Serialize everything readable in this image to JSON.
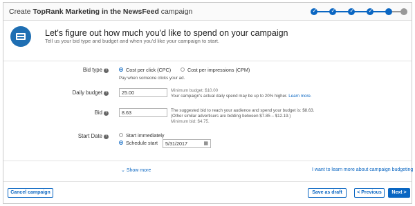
{
  "header": {
    "title_prefix": "Create ",
    "title_campaign": "TopRank Marketing in the NewsFeed",
    "title_suffix": " campaign"
  },
  "intro": {
    "icon": "credit-card-icon",
    "heading": "Let's figure out how much you'd like to spend on your campaign",
    "subtext": "Tell us your bid type and budget and when you'd like your campaign to start."
  },
  "form": {
    "bid_type": {
      "label": "Bid type",
      "option_cpc": "Cost per click (CPC)",
      "option_cpm": "Cost per impressions (CPM)",
      "selected": "cpc",
      "hint": "Pay when someone clicks your ad."
    },
    "daily_budget": {
      "label": "Daily budget",
      "value": "25.00",
      "min_text": "Minimum budget: $10.00",
      "note_text": "Your campaign's actual daily spend may be up to 20% higher.",
      "learn_more": "Learn more."
    },
    "bid": {
      "label": "Bid",
      "value": "8.63",
      "suggested_text": "The suggested bid to reach your audience and spend your budget is: $8.63.",
      "range_text": "(Other similar advertisers are bidding between $7.85 – $12.19.)",
      "min_text": "Minimum bid: $4.75."
    },
    "start_date": {
      "label": "Start Date",
      "option_immediately": "Start immediately",
      "option_schedule": "Schedule start",
      "selected": "schedule",
      "date_value": "5/31/2017"
    }
  },
  "footer_links": {
    "show_more": "Show more",
    "learn_budgeting": "I want to learn more about campaign budgeting"
  },
  "buttons": {
    "cancel": "Cancel campaign",
    "save_draft": "Save as draft",
    "previous": "< Previous",
    "next": "Next >"
  },
  "colors": {
    "accent": "#0a66c2",
    "icon_bg": "#1f6fb3"
  }
}
